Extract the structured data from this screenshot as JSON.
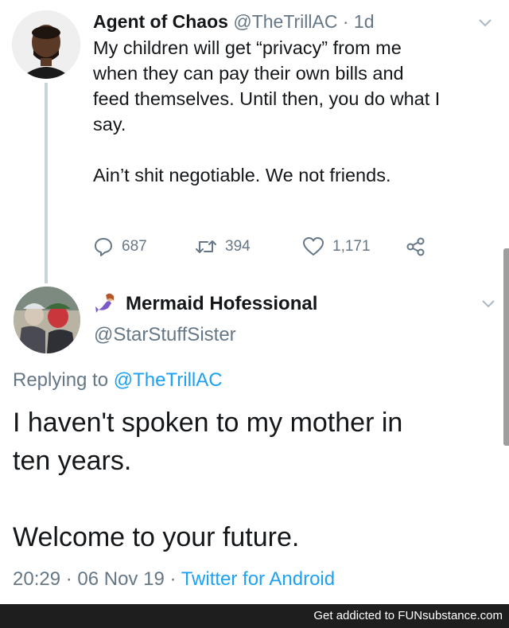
{
  "tweet1": {
    "author_name": "Agent of Chaos",
    "author_handle": "@TheTrillAC",
    "separator": "·",
    "time": "1d",
    "body_lines": [
      "My children will get “privacy” from me",
      "when they can pay their own bills and",
      "feed themselves. Until then, you do what I",
      "say."
    ],
    "body_second": "Ain’t shit negotiable. We not friends.",
    "reply_count": "687",
    "retweet_count": "394",
    "like_count": "1,171"
  },
  "tweet2": {
    "author_name": "Mermaid Hofessional",
    "author_handle": "@StarStuffSister",
    "replying_prefix": "Replying to",
    "replying_mention": "@TheTrillAC",
    "body_lines": [
      "I haven't spoken to my mother in",
      "ten years."
    ],
    "body_second": "Welcome to your future.",
    "timestamp": "20:29 · 06 Nov 19 ·",
    "source": "Twitter for Android"
  },
  "footer": {
    "text": "Get addicted to FUNsubstance.com"
  },
  "colors": {
    "text_primary": "#14171a",
    "text_secondary": "#657786",
    "accent": "#1da1f2",
    "thread_line": "#c8d2d9",
    "footer_bg": "#1e1e1e"
  }
}
